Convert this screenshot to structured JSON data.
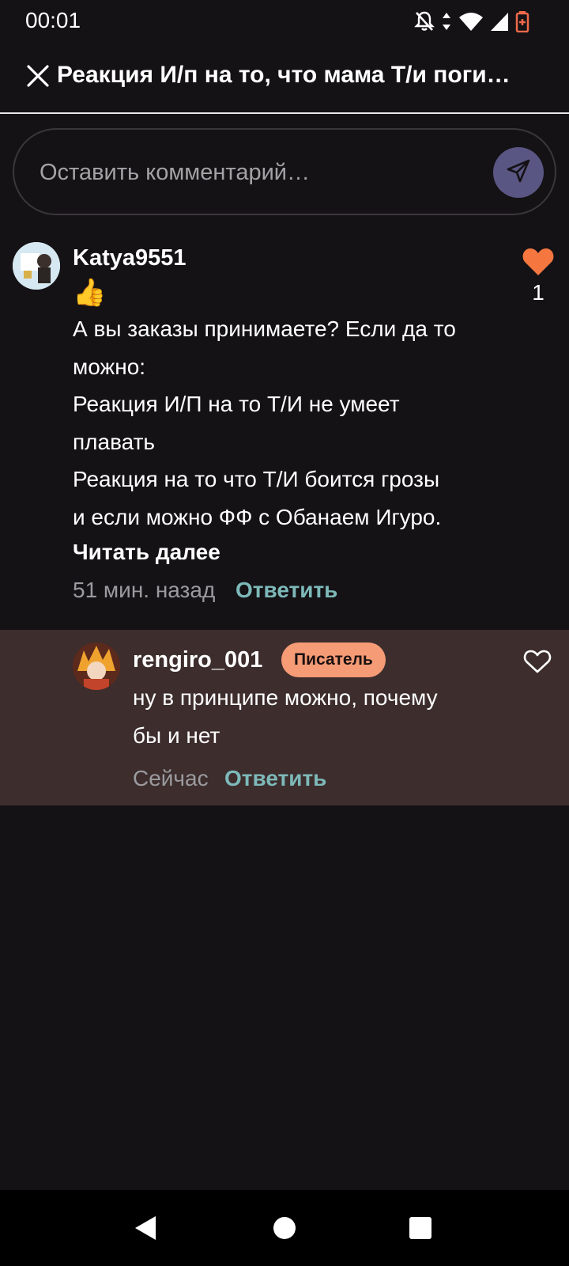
{
  "status_bar": {
    "time": "00:01",
    "icons": [
      "bell-off-icon",
      "data-arrows-icon",
      "wifi-icon",
      "signal-icon",
      "battery-low-icon"
    ],
    "battery_color": "#f06a4b"
  },
  "header": {
    "title": "Реакция И/п на то, что мама Т/и поги…",
    "close_icon": "close-icon"
  },
  "comment_input": {
    "placeholder": "Оставить комментарий…",
    "send_icon": "send-icon"
  },
  "comments": [
    {
      "username": "Katya9551",
      "emoji": "👍",
      "text_lines": [
        "А вы заказы принимаете? Если да то",
        "можно:",
        "Реакция И/П на то Т/И не умеет",
        "плавать",
        "Реакция на то что Т/И боится грозы",
        "и если можно ФФ с Обанаем Игуро."
      ],
      "read_more": "Читать далее",
      "time": "51 мин. назад",
      "reply_label": "Ответить",
      "likes": "1",
      "liked": true
    }
  ],
  "replies": [
    {
      "username": "rengiro_001",
      "badge": "Писатель",
      "text_lines": [
        "ну в принципе можно, почему",
        "бы и нет"
      ],
      "time": "Сейчас",
      "reply_label": "Ответить",
      "liked": false
    }
  ],
  "colors": {
    "background": "#141215",
    "reply_background": "#3d2d2d",
    "accent_link": "#7eb9b9",
    "like_active": "#f5763f",
    "badge": "#f59b75",
    "send_button": "#5a5683"
  },
  "nav_bar": {
    "buttons": [
      "back-icon",
      "home-icon",
      "recents-icon"
    ]
  }
}
